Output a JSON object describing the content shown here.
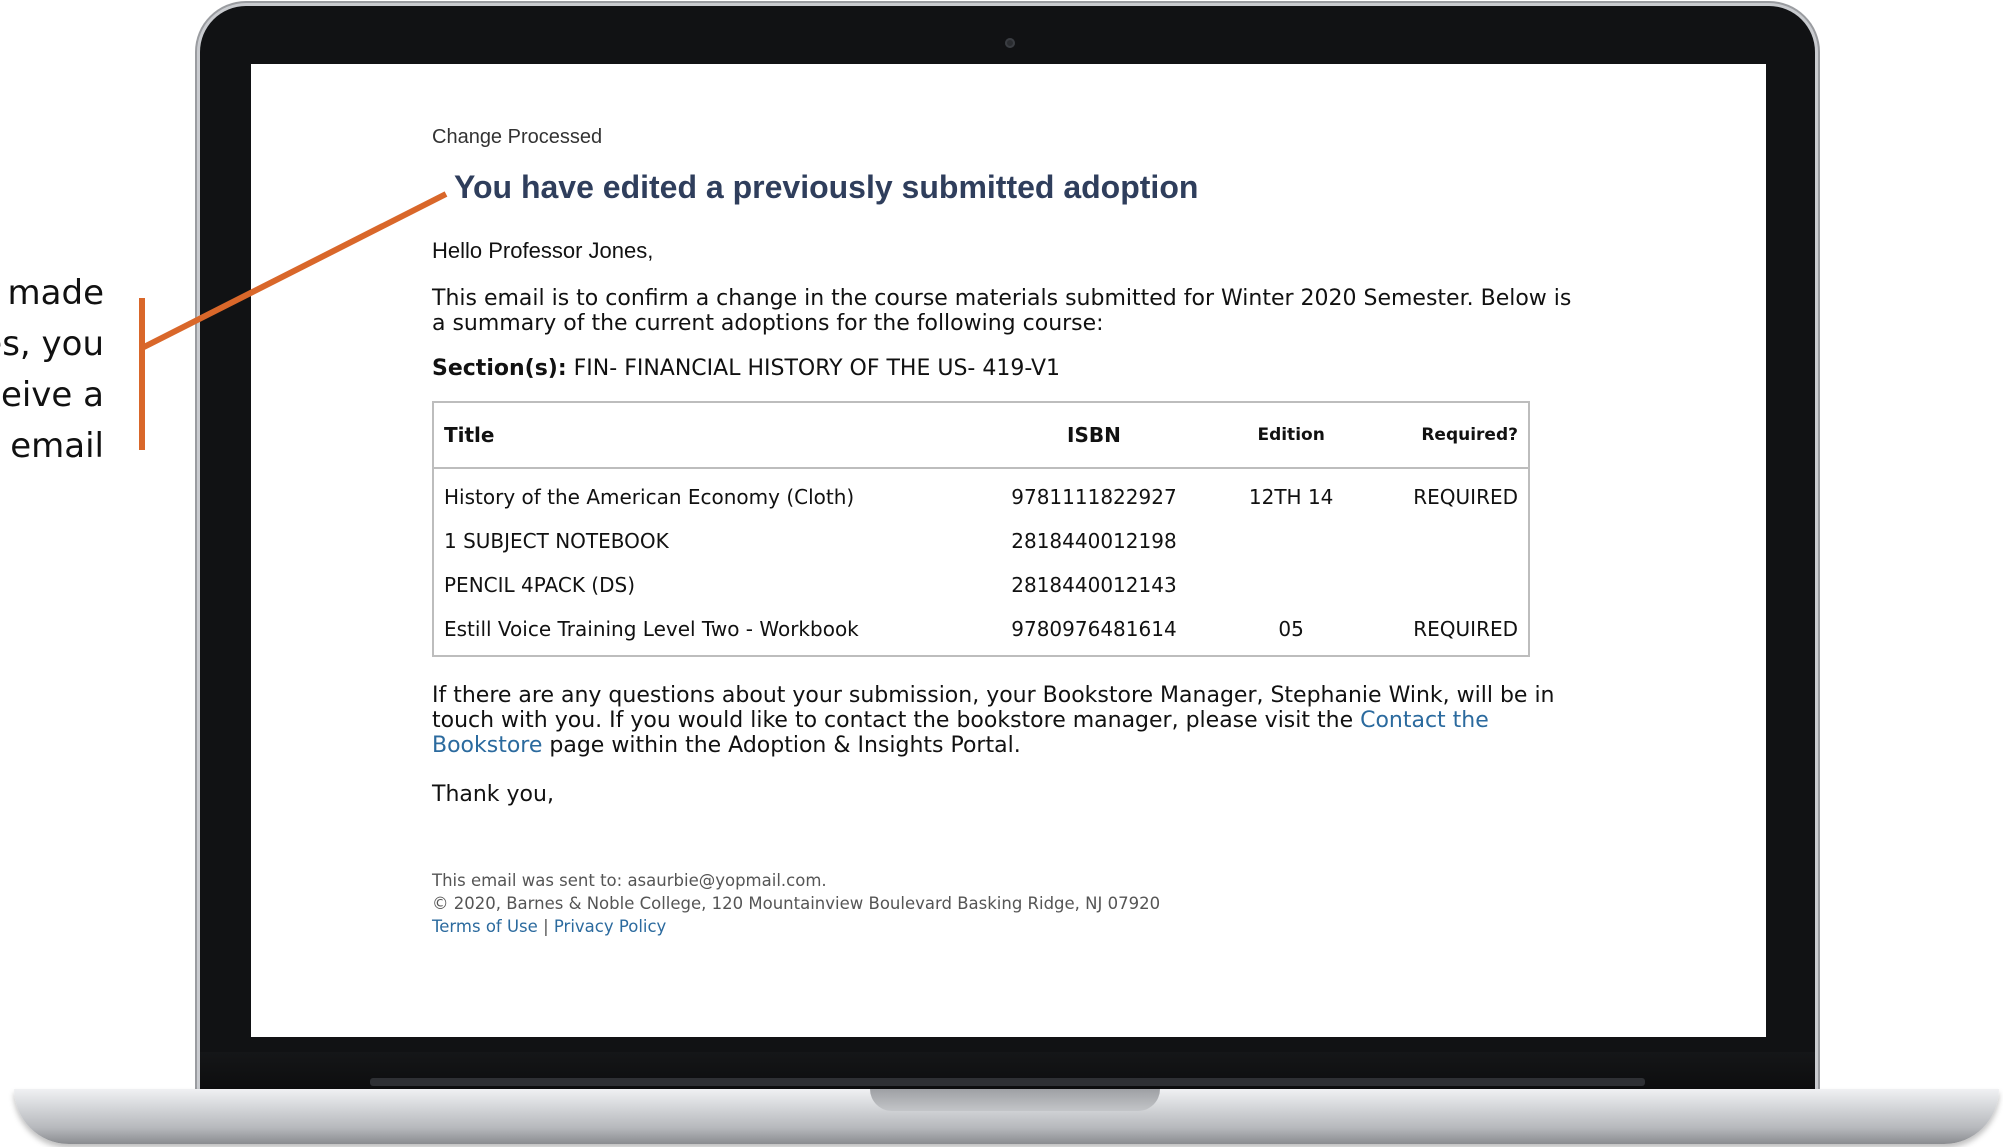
{
  "callout": {
    "lines": [
      "made",
      "es, you",
      "ceive a",
      "email"
    ],
    "color": "#d9672a"
  },
  "email": {
    "brand_text": "Change Processed",
    "headline": "You have edited a previously submitted adoption",
    "greeting": "Hello Professor Jones,",
    "intro": "This email is to confirm a change in the course materials submitted for Winter 2020 Semester. Below is a summary of the current adoptions for the following course:",
    "section_label": "Section(s):",
    "section_value": "FIN- FINANCIAL HISTORY OF THE US- 419-V1",
    "table": {
      "headers": {
        "title": "Title",
        "isbn": "ISBN",
        "edition": "Edition",
        "required": "Required?"
      },
      "rows": [
        {
          "title": "History of the American Economy (Cloth)",
          "isbn": "9781111822927",
          "edition": "12TH 14",
          "required": "REQUIRED"
        },
        {
          "title": "1 SUBJECT NOTEBOOK",
          "isbn": "2818440012198",
          "edition": "",
          "required": ""
        },
        {
          "title": "PENCIL 4PACK (DS)",
          "isbn": "2818440012143",
          "edition": "",
          "required": ""
        },
        {
          "title": "Estill Voice Training Level Two - Workbook",
          "isbn": "9780976481614",
          "edition": "05",
          "required": "REQUIRED"
        }
      ]
    },
    "questions_before": "If there are any questions about your submission, your Bookstore Manager, Stephanie Wink, will be in touch with you. If you would like to contact the bookstore manager, please visit the ",
    "contact_link": "Contact the Bookstore",
    "questions_after": " page within the Adoption & Insights Portal.",
    "thanks": "Thank you,",
    "footer": {
      "sent_to": "This email was sent to: asaurbie@yopmail.com.",
      "copyright": "© 2020, Barnes & Noble College, 120 Mountainview Boulevard Basking Ridge, NJ 07920",
      "terms_link": "Terms of Use",
      "separator": "|",
      "privacy_link": "Privacy Policy"
    }
  },
  "colors": {
    "headline": "#2f3e5c",
    "link": "#2b6a9e",
    "table_border": "#bdbdbd",
    "laptop_bezel": "#111214"
  }
}
